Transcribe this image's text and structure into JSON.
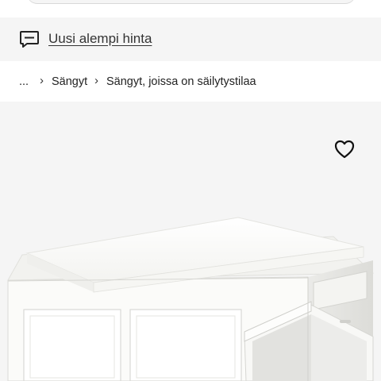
{
  "notice": {
    "icon": "chat-bubble-icon",
    "text": "Uusi alempi hinta"
  },
  "breadcrumb": {
    "items": [
      "...",
      "Sängyt",
      "Sängyt, joissa on säilytystilaa"
    ]
  },
  "product": {
    "favorite_icon": "heart-outline-icon",
    "image": "white-storage-bed-with-drawers"
  }
}
